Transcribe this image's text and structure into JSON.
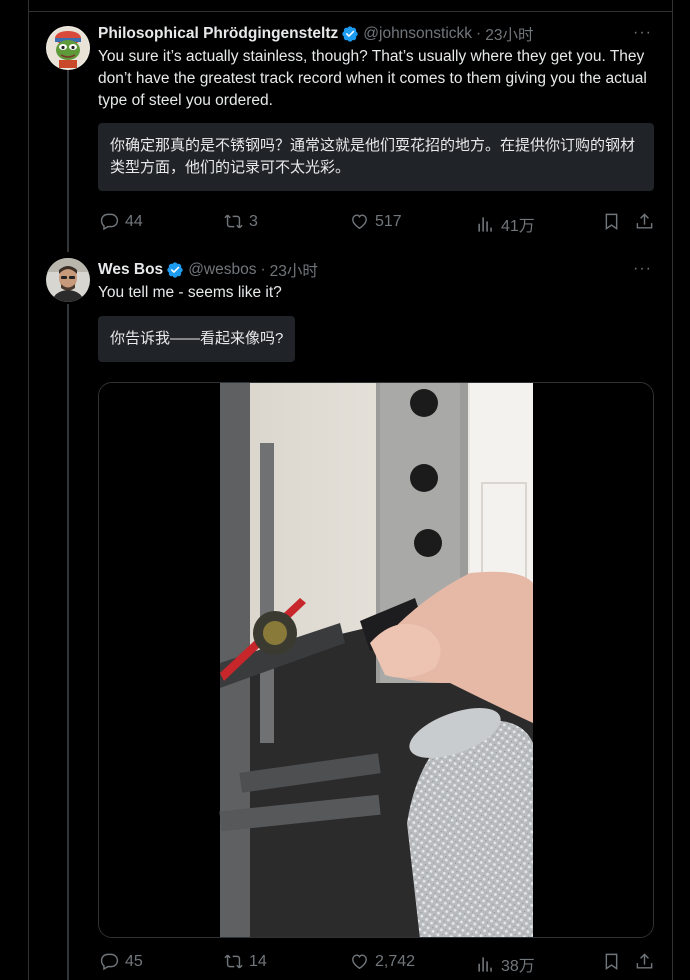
{
  "tweets": [
    {
      "display_name": "Philosophical Phrödgingensteltz",
      "handle": "@johnsonstickk",
      "separator": "·",
      "time": "23小时",
      "more": "···",
      "text": "You sure it’s actually stainless, though? That’s usually where they get you. They don’t have the greatest track record when it comes to them giving you the actual type of steel you ordered.",
      "translation": "你确定那真的是不锈钢吗？通常这就是他们耍花招的地方。在提供你订购的钢材类型方面，他们的记录可不太光彩。",
      "replies": "44",
      "retweets": "3",
      "likes": "517",
      "views": "41万"
    },
    {
      "display_name": "Wes Bos",
      "handle": "@wesbos",
      "separator": "·",
      "time": "23小时",
      "more": "···",
      "text": "You tell me - seems like it?",
      "translation": "你告诉我——看起来像吗?",
      "replies": "45",
      "retweets": "14",
      "likes": "2,742",
      "views": "38万"
    }
  ],
  "colors": {
    "background": "#000000",
    "text": "#e7e9ea",
    "muted": "#71767b",
    "verified": "#1d9bf0",
    "translation_bg": "#202327"
  },
  "icons": [
    "reply-icon",
    "retweet-icon",
    "like-icon",
    "views-icon",
    "bookmark-icon",
    "share-icon",
    "verified-icon",
    "more-icon"
  ]
}
